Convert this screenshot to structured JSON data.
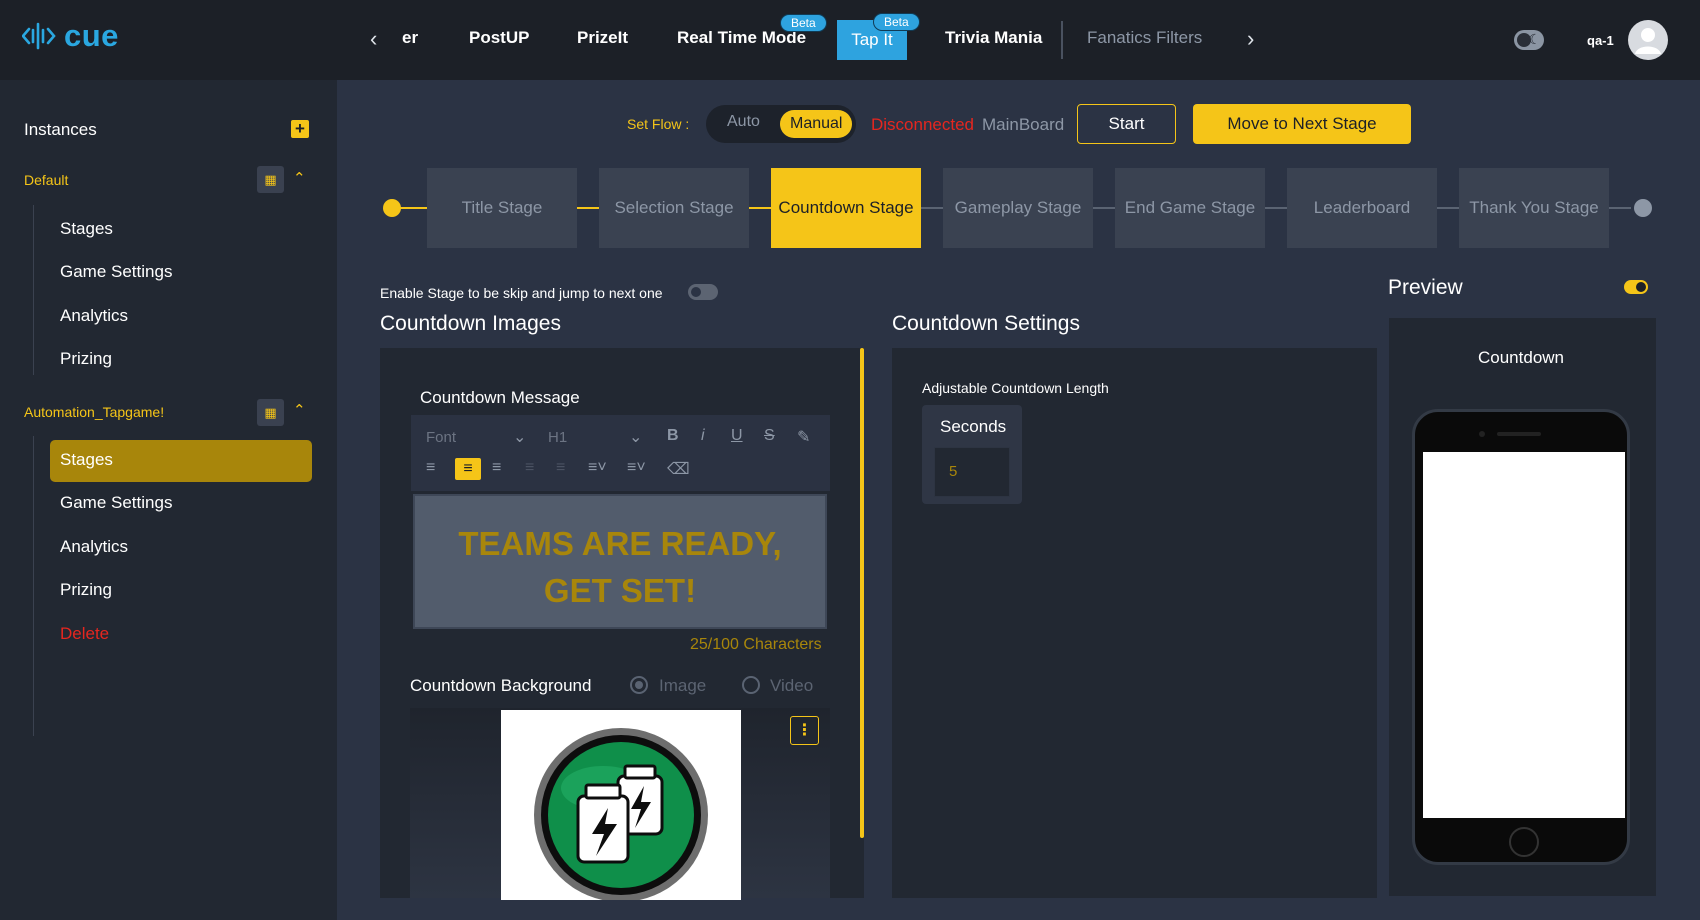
{
  "app": {
    "logo_text": "cue",
    "accent": "#f5c518",
    "brand": "#2aa7e0"
  },
  "nav": {
    "tabs": [
      {
        "label": "er"
      },
      {
        "label": "PostUP"
      },
      {
        "label": "PrizeIt"
      },
      {
        "label": "Real Time Mode",
        "badge": "Beta"
      },
      {
        "label": "Tap It",
        "badge": "Beta",
        "active": true
      },
      {
        "label": "Trivia Mania"
      },
      {
        "label": "Fanatics Filters"
      }
    ],
    "user": "qa-1"
  },
  "sidebar": {
    "title": "Instances",
    "groups": [
      {
        "title": "Default",
        "items": [
          "Stages",
          "Game Settings",
          "Analytics",
          "Prizing"
        ]
      },
      {
        "title": "Automation_Tapgame!",
        "items": [
          "Stages",
          "Game Settings",
          "Analytics",
          "Prizing",
          "Delete"
        ],
        "active_item": "Stages"
      }
    ]
  },
  "controls": {
    "set_flow_label": "Set Flow :",
    "flow_auto": "Auto",
    "flow_manual": "Manual",
    "status": "Disconnected",
    "board": "MainBoard",
    "start": "Start",
    "next_stage": "Move to Next Stage"
  },
  "stages": [
    "Title Stage",
    "Selection Stage",
    "Countdown Stage",
    "Gameplay Stage",
    "End Game Stage",
    "Leaderboard",
    "Thank You Stage"
  ],
  "active_stage": "Countdown Stage",
  "countdown": {
    "skip_label": "Enable Stage to be skip and jump to next one",
    "images_title": "Countdown Images",
    "message_label": "Countdown Message",
    "font_placeholder": "Font",
    "heading_value": "H1",
    "message_line1": "TEAMS ARE READY,",
    "message_line2": "GET SET!",
    "char_count": "25/100 Characters",
    "background_label": "Countdown Background",
    "bg_image": "Image",
    "bg_video": "Video",
    "settings_title": "Countdown Settings",
    "length_label": "Adjustable Countdown Length",
    "seconds_label": "Seconds",
    "seconds_value": "5"
  },
  "preview": {
    "title": "Preview",
    "caption": "Countdown"
  }
}
